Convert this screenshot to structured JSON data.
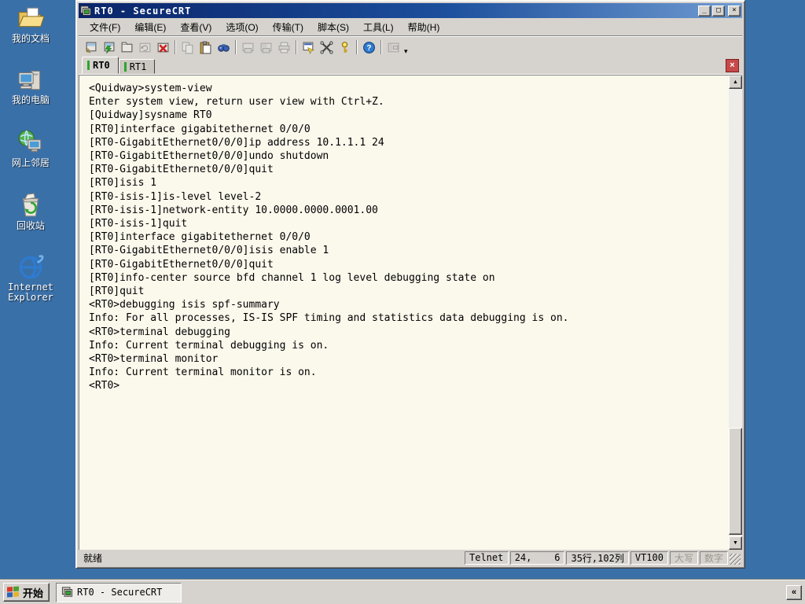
{
  "desktop": {
    "icons": [
      {
        "name": "my-documents",
        "label": "我的文档"
      },
      {
        "name": "my-computer",
        "label": "我的电脑"
      },
      {
        "name": "network-places",
        "label": "网上邻居"
      },
      {
        "name": "recycle-bin",
        "label": "回收站"
      },
      {
        "name": "internet-explorer",
        "label": "Internet\nExplorer"
      }
    ]
  },
  "window": {
    "title": "RT0 - SecureCRT",
    "controls": {
      "minimize": "_",
      "maximize": "□",
      "close": "×"
    },
    "menus": [
      "文件(F)",
      "编辑(E)",
      "查看(V)",
      "选项(O)",
      "传输(T)",
      "脚本(S)",
      "工具(L)",
      "帮助(H)"
    ],
    "toolbar_icons": [
      "quick-connect",
      "connect",
      "connect-in-tab",
      "reconnect",
      "disconnect",
      "copy",
      "paste",
      "find",
      "print",
      "print-selection",
      "printer",
      "session-options",
      "keymap-editor",
      "key-generator",
      "help",
      "session-manager"
    ],
    "tabs": [
      {
        "label": "RT0",
        "active": true
      },
      {
        "label": "RT1",
        "active": false
      }
    ],
    "tab_close": "×",
    "statusbar": {
      "ready": "就绪",
      "protocol": "Telnet",
      "cursor": "24,    6",
      "size": "35行,102列",
      "emulation": "VT100",
      "caps": "大写",
      "num": "数字"
    }
  },
  "terminal": {
    "lines": [
      "<Quidway>system-view",
      "Enter system view, return user view with Ctrl+Z.",
      "[Quidway]sysname RT0",
      "[RT0]interface gigabitethernet 0/0/0",
      "[RT0-GigabitEthernet0/0/0]ip address 10.1.1.1 24",
      "[RT0-GigabitEthernet0/0/0]undo shutdown",
      "[RT0-GigabitEthernet0/0/0]quit",
      "[RT0]isis 1",
      "[RT0-isis-1]is-level level-2",
      "[RT0-isis-1]network-entity 10.0000.0000.0001.00",
      "[RT0-isis-1]quit",
      "[RT0]interface gigabitethernet 0/0/0",
      "[RT0-GigabitEthernet0/0/0]isis enable 1",
      "[RT0-GigabitEthernet0/0/0]quit",
      "[RT0]info-center source bfd channel 1 log level debugging state on",
      "[RT0]quit",
      "<RT0>debugging isis spf-summary",
      "Info: For all processes, IS-IS SPF timing and statistics data debugging is on.",
      "<RT0>terminal debugging",
      "Info: Current terminal debugging is on.",
      "<RT0>terminal monitor",
      "Info: Current terminal monitor is on.",
      "<RT0>"
    ]
  },
  "taskbar": {
    "start": "开始",
    "task": "RT0 - SecureCRT",
    "overflow": "«"
  },
  "colors": {
    "desktop": "#3A70A8",
    "chrome": "#D6D3CE",
    "terminal_bg": "#FBF8EC",
    "titlebar_left": "#0A246A",
    "titlebar_right": "#6F9BD1",
    "tab_indicator": "#2DA52D",
    "close_red": "#C23B3B"
  }
}
